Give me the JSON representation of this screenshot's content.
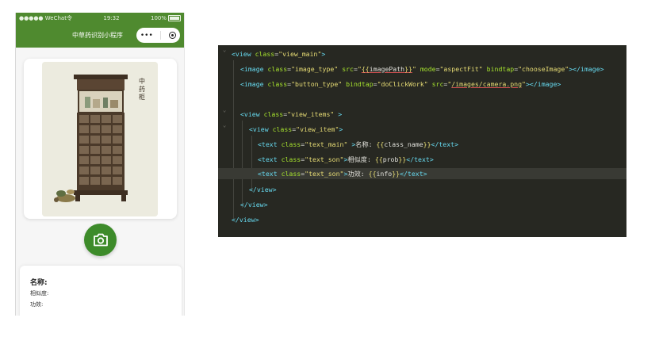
{
  "phone": {
    "status": {
      "carrier": "●●●●● WeChat令",
      "time": "19:32",
      "battery": "100%"
    },
    "navbar": {
      "title": "中草药识别小程序",
      "more_glyph": "•••"
    },
    "painting": {
      "calligraphy": "中药柜"
    },
    "result": {
      "name_label": "名称:",
      "prob_label": "相似度:",
      "info_label": "功效:"
    },
    "colors": {
      "accent": "#3d8b2a",
      "navbar": "#4f8a2f"
    },
    "icons": {
      "camera": "camera-icon",
      "more": "more-dots-icon",
      "target": "record-target-icon"
    }
  },
  "code": {
    "l1": {
      "open": "<view ",
      "a1": "class",
      "eq": "=",
      "v1": "\"view_main\"",
      "close": ">"
    },
    "l2": {
      "open": "<image ",
      "a1": "class",
      "v1": "\"image_type\"",
      "a2": "src",
      "q1": "\"",
      "t1": "{{",
      "v2": "imagePath",
      "t2": "}}",
      "q2": "\"",
      "a3": "mode",
      "v3": "\"aspectFit\"",
      "a4": "bindtap",
      "v4": "\"chooseImage\"",
      "mid": ">",
      "close": "</image>"
    },
    "l3": {
      "open": "<image ",
      "a1": "class",
      "v1": "\"button_type\"",
      "a2": "bindtap",
      "v2": "\"doClickWork\"",
      "a3": "src",
      "q1": "\"",
      "v3": "/images/camera.png",
      "q2": "\"",
      "mid": ">",
      "close": "</image>"
    },
    "l5": {
      "open": "<view ",
      "a1": "class",
      "v1": "\"view_items\"",
      "close": " >"
    },
    "l6": {
      "open": "<view ",
      "a1": "class",
      "v1": "\"view_item\"",
      "close": ">"
    },
    "l7": {
      "open": "<text ",
      "a1": "class",
      "v1": "\"text_main\"",
      "mid": " >",
      "txt": "名称: ",
      "t1": "{{",
      "v2": "class_name",
      "t2": "}}",
      "close": "</text>"
    },
    "l8": {
      "open": "<text ",
      "a1": "class",
      "v1": "\"text_son\"",
      "mid": ">",
      "txt": "相似度: ",
      "t1": "{{",
      "v2": "prob",
      "t2": "}}",
      "close": "</text>"
    },
    "l9": {
      "open": "<text ",
      "a1": "class",
      "v1": "\"text_son\"",
      "mid": ">",
      "txt": "功效: ",
      "t1": "{{",
      "v2": "info",
      "t2": "}}",
      "close": "</text>"
    },
    "l10": "</view>",
    "l11": "</view>",
    "l12": "</view>",
    "fold_glyph": "⌄",
    "colors": {
      "background": "#272822",
      "tag": "#66d9ef",
      "attr": "#a6e22e",
      "string": "#e6db74"
    }
  }
}
